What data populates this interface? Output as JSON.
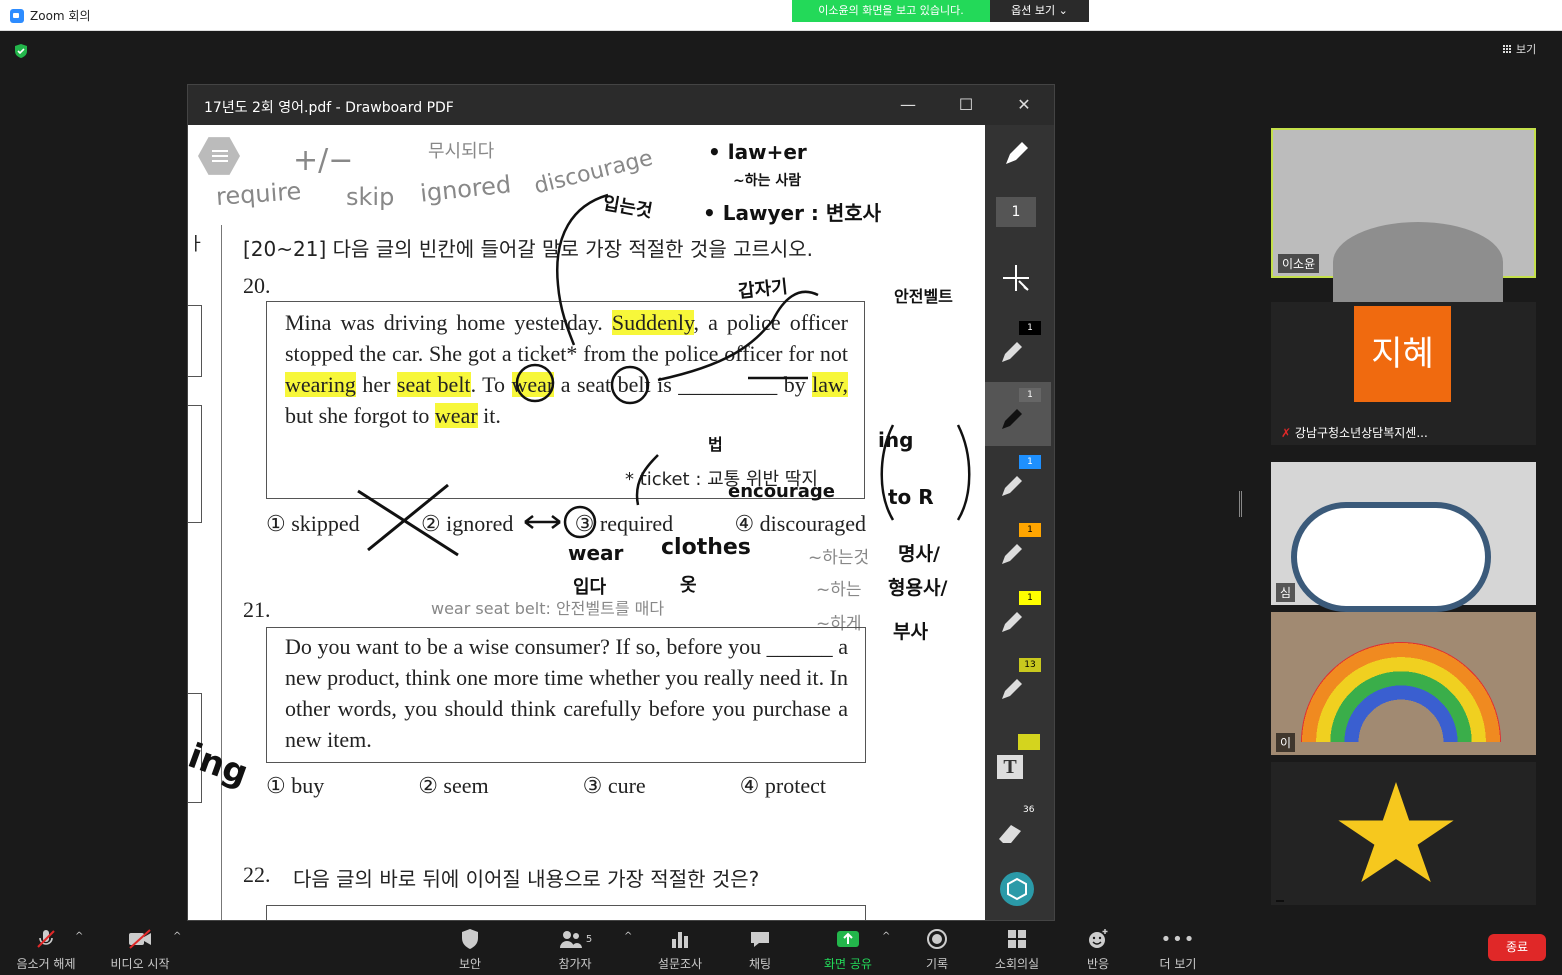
{
  "titlebar": {
    "title": "Zoom 회의"
  },
  "share_banner": {
    "message": "이소윤의 화면을 보고 있습니다.",
    "options_label": "옵션 보기 ⌄"
  },
  "view_button": {
    "label": "보기"
  },
  "pdf_window": {
    "title": "17년도 2회 영어.pdf - Drawboard PDF",
    "page_content": {
      "instruction": "[20~21] 다음 글의 빈칸에 들어갈 말로 가장 적절한 것을 고르시오.",
      "q20": {
        "number": "20.",
        "text_1": "Mina was driving home yesterday.",
        "highlight_suddenly": "Suddenly",
        "text_2": ", a police officer stopped the car. She got a ticket* from the police officer for not",
        "highlight_wearing": "wearing",
        "text_3": "her",
        "highlight_seat_belt": "seat belt",
        "text_4": ". To",
        "highlight_wear1": "wear",
        "text_5": "a seat belt is _________ by",
        "highlight_law": "law,",
        "text_6": "but she forgot to",
        "highlight_wear2": "wear",
        "text_7": "it.",
        "footnote": "* ticket : 교통 위반 딱지",
        "options": [
          "① skipped",
          "② ignored",
          "③ required",
          "④ discouraged"
        ]
      },
      "q21": {
        "number": "21.",
        "text": "Do you want to be a wise consumer? If so, before you ______ a new product, think one more time whether you really need it. In other words, you should think carefully before you purchase a new item.",
        "options": [
          "① buy",
          "② seem",
          "③ cure",
          "④ protect"
        ]
      },
      "q22": {
        "number": "22.",
        "text": "다음 글의 바로 뒤에 이어질 내용으로 가장 적절한 것은?"
      },
      "annotations": {
        "plus_minus": "+/−",
        "korean_top": "무시되다",
        "require": "require",
        "skip": "skip",
        "ignored": "ignored",
        "discourage": "discourage",
        "wear_kor": "입는것",
        "lawter": "• law+er",
        "lawter_sub": "~하는 사람",
        "lawyer": "• Lawyer : 변호사",
        "suddenly_kor": "갑자기",
        "seatbelt_kor": "안전벨트",
        "law_kor": "법",
        "ing": "ing",
        "to_r": "to R",
        "encourage": "encourage",
        "wear_note": "wear",
        "wear_note_kor": "입다",
        "clothes": "clothes",
        "clothes_kor": "옷",
        "wear_seat_belt": "wear seat belt: 안전벨트를 매다",
        "hanun_geot": "~하는것",
        "hanun": "~하는",
        "hage": "~하게",
        "myeongsa": "명사/",
        "hyeongyongsa": "형용사/",
        "busa": "부사",
        "margin_ing": "ing"
      }
    },
    "sidebar": {
      "page_number": "1",
      "tools": [
        {
          "badge": "1",
          "badge_color": "#000000",
          "pen_color": "#ffffff"
        },
        {
          "badge": "1",
          "badge_color": "#666666",
          "pen_color": "#ffffff"
        },
        {
          "badge": "1",
          "badge_color": "#1e90ff",
          "pen_color": "#ffffff"
        },
        {
          "badge": "1",
          "badge_color": "#ffa500",
          "pen_color": "#ffffff"
        },
        {
          "badge": "1",
          "badge_color": "#ffff00",
          "pen_color": "#ffffff"
        },
        {
          "badge": "13",
          "badge_color": "#c8c81e",
          "pen_color": "#ffffff"
        }
      ],
      "eraser_badge": "36"
    }
  },
  "participants": [
    {
      "name": "이소윤"
    },
    {
      "name": "강남구청소년상담복지센...",
      "avatar_text": "지혜",
      "avatar_color": "#f06a0f"
    },
    {
      "name": "심"
    },
    {
      "name": "이"
    },
    {
      "name": ""
    }
  ],
  "toolbar": {
    "mute": "음소거 해제",
    "video": "비디오 시작",
    "security": "보안",
    "participants": "참가자",
    "participants_count": "5",
    "polls": "설문조사",
    "chat": "채팅",
    "share": "화면 공유",
    "record": "기록",
    "breakout": "소회의실",
    "reactions": "반응",
    "more": "더 보기",
    "end": "종료"
  }
}
